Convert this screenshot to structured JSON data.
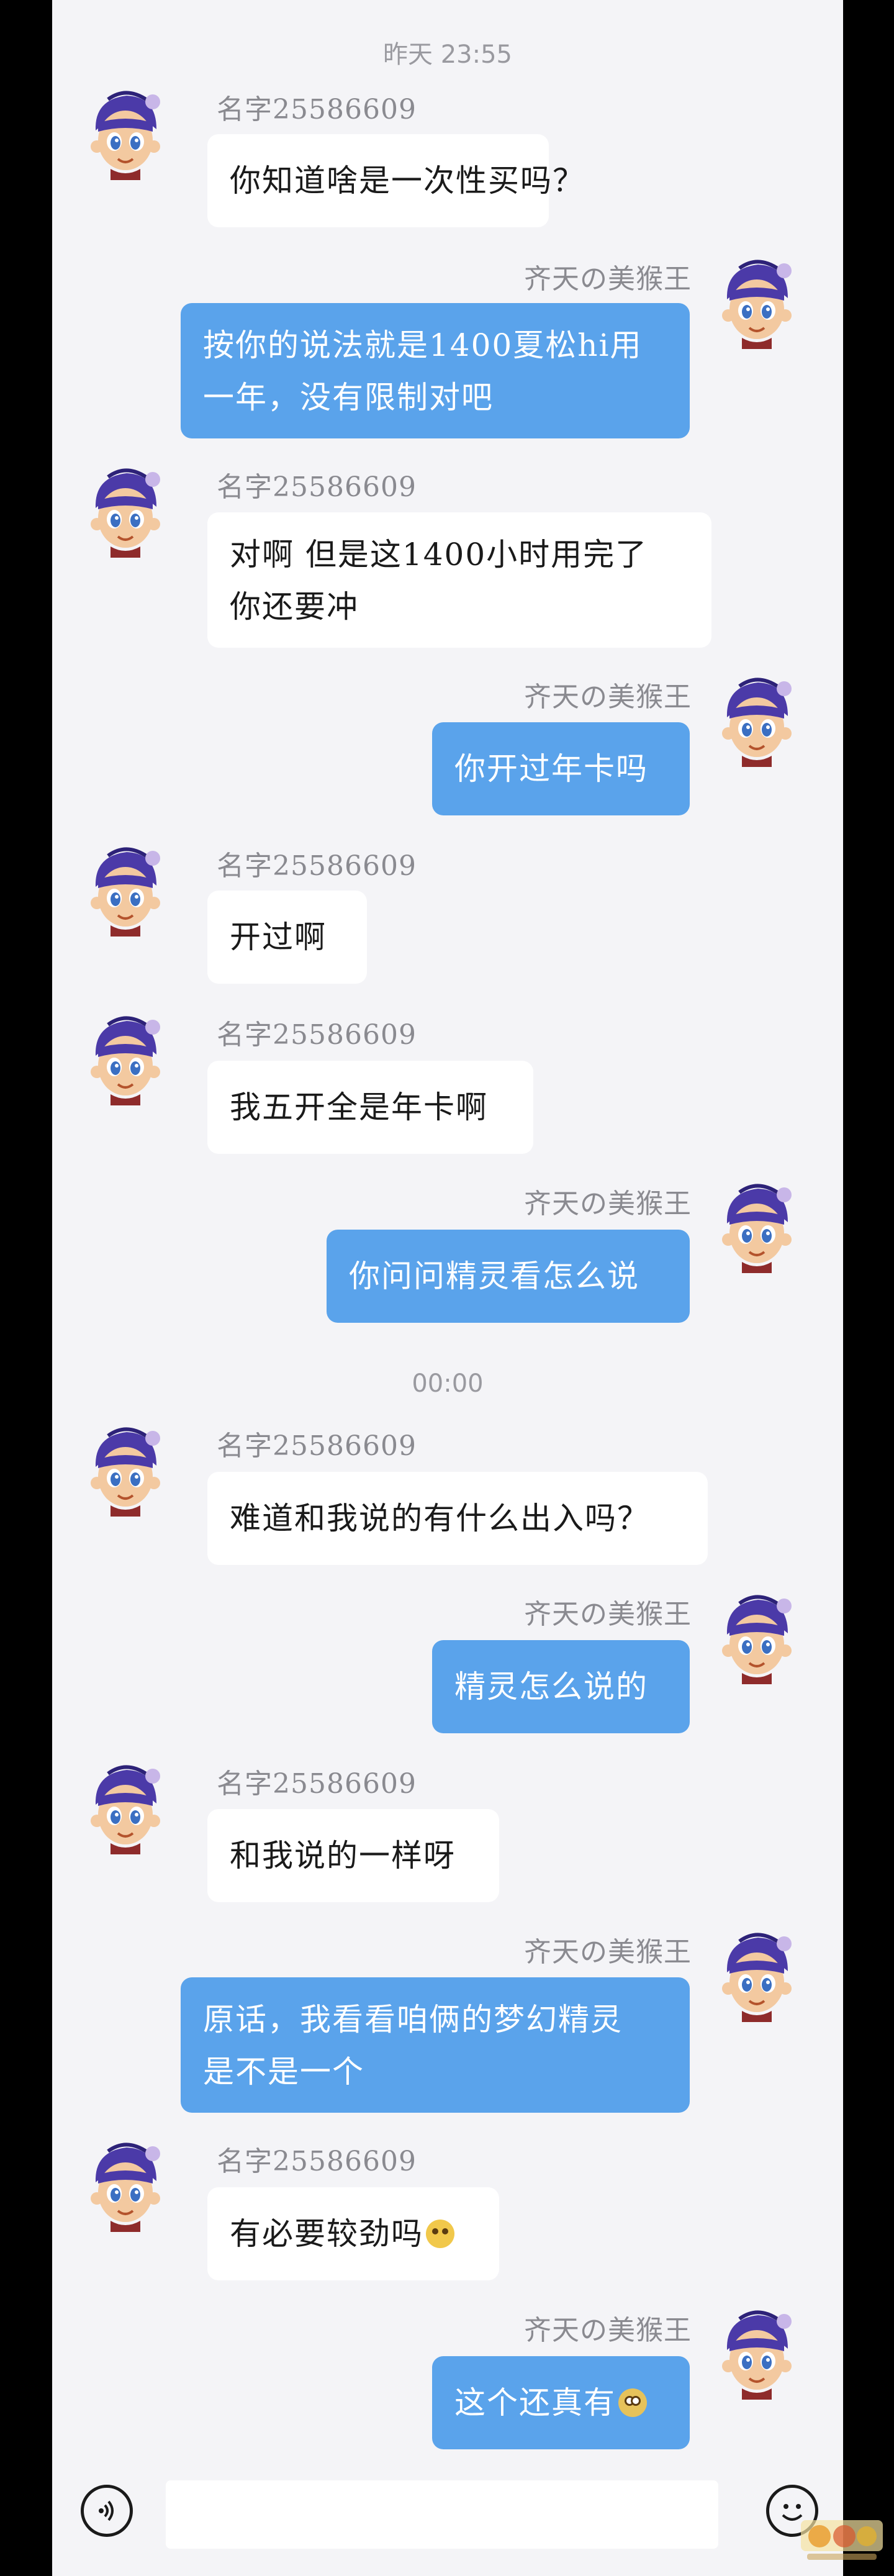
{
  "contacts": {
    "left_name": "名字25586609",
    "right_name": "齐天の美猴王"
  },
  "timestamps": [
    "昨天 23:55",
    "00:00"
  ],
  "messages": [
    {
      "side": "in",
      "text_lines": [
        "你知道啥是一次性买吗？"
      ]
    },
    {
      "side": "out",
      "text_lines": [
        "按你的说法就是1400夏松hi用",
        "一年，没有限制对吧"
      ]
    },
    {
      "side": "in",
      "text_lines": [
        " 对啊  但是这1400小时用完了",
        "你还要冲"
      ]
    },
    {
      "side": "out",
      "text_lines": [
        "你开过年卡吗"
      ]
    },
    {
      "side": "in",
      "text_lines": [
        "开过啊"
      ]
    },
    {
      "side": "in",
      "text_lines": [
        "我五开全是年卡啊"
      ]
    },
    {
      "side": "out",
      "text_lines": [
        "你问问精灵看怎么说"
      ]
    },
    {
      "side": "in",
      "text_lines": [
        "难道和我说的有什么出入吗？"
      ]
    },
    {
      "side": "out",
      "text_lines": [
        "精灵怎么说的"
      ]
    },
    {
      "side": "in",
      "text_lines": [
        "和我说的一样呀"
      ]
    },
    {
      "side": "out",
      "text_lines": [
        "原话，我看看咱俩的梦幻精灵",
        "是不是一个"
      ]
    },
    {
      "side": "in",
      "text_lines": [
        "有必要较劲吗"
      ],
      "emoji": "raised-eyebrow-emoji"
    },
    {
      "side": "out",
      "text_lines": [
        "这个还真有"
      ],
      "emoji": "flushed-emoji"
    }
  ],
  "input": {
    "placeholder": "",
    "voice_icon": "voice-icon",
    "emoji_icon": "smiley-icon"
  },
  "colors": {
    "bubble_out": "#5aa3eb",
    "bubble_in": "#ffffff",
    "background": "#f4f4f7"
  }
}
